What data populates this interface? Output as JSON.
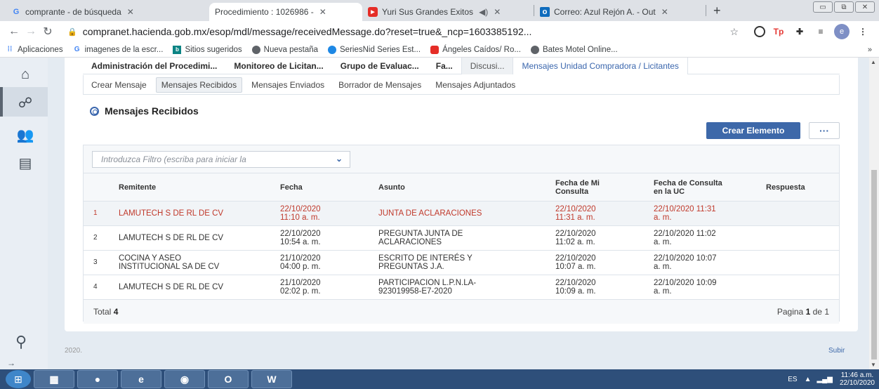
{
  "browser": {
    "tabs": [
      {
        "label": "comprante - de búsqueda",
        "icon": "google-icon",
        "active": false
      },
      {
        "label": "Procedimiento : 1026986 -",
        "icon": "",
        "active": true
      },
      {
        "label": "Yuri Sus Grandes Exitos",
        "icon": "youtube-icon",
        "active": false
      },
      {
        "label": "Correo: Azul Rejón A. - Out",
        "icon": "outlook-icon",
        "active": false
      }
    ],
    "url": "compranet.hacienda.gob.mx/esop/mdl/message/receivedMessage.do?reset=true&_ncp=1603385192...",
    "profile_initial": "e",
    "bookmarks": [
      {
        "label": "Aplicaciones",
        "icon": "apps-icon"
      },
      {
        "label": "imagenes de la escr...",
        "icon": "google-icon"
      },
      {
        "label": "Sitios sugeridos",
        "icon": "bing-icon"
      },
      {
        "label": "Nueva pestaña",
        "icon": "globe-icon"
      },
      {
        "label": "SeriesNid Series Est...",
        "icon": "series-icon"
      },
      {
        "label": "Ángeles Caídos/ Ro...",
        "icon": "youtube-icon"
      },
      {
        "label": "Bates Motel Online...",
        "icon": "globe-icon"
      }
    ]
  },
  "app": {
    "main_tabs": [
      {
        "label": "Administración del Procedimi..."
      },
      {
        "label": "Monitoreo de Licitan..."
      },
      {
        "label": "Grupo de Evaluac..."
      },
      {
        "label": "Fa..."
      },
      {
        "label": "Discusi..."
      },
      {
        "label": "Mensajes Unidad Compradora / Licitantes"
      }
    ],
    "sub_tabs": [
      {
        "label": "Crear Mensaje"
      },
      {
        "label": "Mensajes Recibidos"
      },
      {
        "label": "Mensajes Enviados"
      },
      {
        "label": "Borrador de Mensajes"
      },
      {
        "label": "Mensajes Adjuntados"
      }
    ],
    "section_title": "Mensajes Recibidos",
    "create_button": "Crear Elemento",
    "more_button": "···",
    "filter_placeholder": "Introduzca Filtro (escriba para iniciar la",
    "columns": {
      "remitente": "Remitente",
      "fecha": "Fecha",
      "asunto": "Asunto",
      "fecha_mi": [
        "Fecha de Mi",
        "Consulta"
      ],
      "fecha_uc": [
        "Fecha de Consulta",
        "en la UC"
      ],
      "respuesta": "Respuesta"
    },
    "rows": [
      {
        "num": "1",
        "remitente": [
          "LAMUTECH S DE RL DE CV",
          ""
        ],
        "fecha": [
          "22/10/2020",
          "11:10 a. m."
        ],
        "asunto": [
          "JUNTA DE ACLARACIONES",
          ""
        ],
        "fecha_mi": [
          "22/10/2020",
          "11:31 a. m."
        ],
        "fecha_uc": [
          "22/10/2020 11:31",
          "a. m."
        ],
        "respuesta": ""
      },
      {
        "num": "2",
        "remitente": [
          "LAMUTECH S DE RL DE CV",
          ""
        ],
        "fecha": [
          "22/10/2020",
          "10:54 a. m."
        ],
        "asunto": [
          "PREGUNTA JUNTA DE",
          "ACLARACIONES"
        ],
        "fecha_mi": [
          "22/10/2020",
          "11:02 a. m."
        ],
        "fecha_uc": [
          "22/10/2020 11:02",
          "a. m."
        ],
        "respuesta": ""
      },
      {
        "num": "3",
        "remitente": [
          "COCINA Y ASEO",
          "INSTITUCIONAL SA DE CV"
        ],
        "fecha": [
          "21/10/2020",
          "04:00 p. m."
        ],
        "asunto": [
          "ESCRITO DE INTERÉS Y",
          "PREGUNTAS J.A."
        ],
        "fecha_mi": [
          "22/10/2020",
          "10:07 a. m."
        ],
        "fecha_uc": [
          "22/10/2020 10:07",
          "a. m."
        ],
        "respuesta": ""
      },
      {
        "num": "4",
        "remitente": [
          "LAMUTECH S DE RL DE CV",
          ""
        ],
        "fecha": [
          "21/10/2020",
          "02:02 p. m."
        ],
        "asunto": [
          "PARTICIPACION L.P.N.LA-",
          "923019958-E7-2020"
        ],
        "fecha_mi": [
          "22/10/2020",
          "10:09 a. m."
        ],
        "fecha_uc": [
          "22/10/2020 10:09",
          "a. m."
        ],
        "respuesta": ""
      }
    ],
    "total_label": "Total",
    "total_value": "4",
    "page_label": "Pagina",
    "page_current": "1",
    "page_of": "de",
    "page_total": "1",
    "year_text": "2020.",
    "subir": "Subir"
  },
  "taskbar": {
    "lang": "ES",
    "time": "11:46 a.m.",
    "date": "22/10/2020"
  },
  "colors": {
    "accent": "#3d68a9",
    "selected_row_text": "#c0392b"
  }
}
